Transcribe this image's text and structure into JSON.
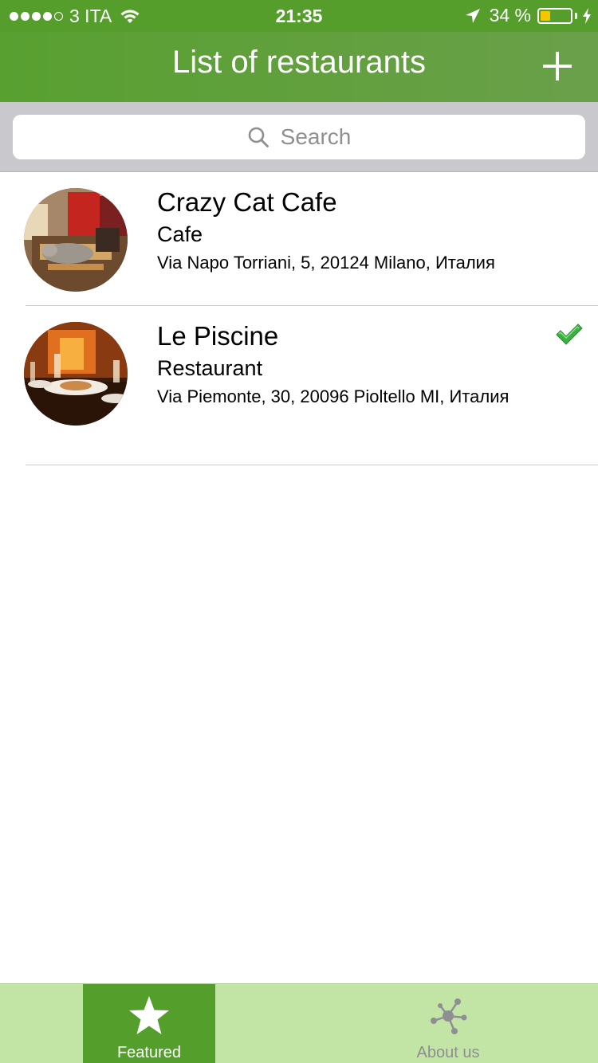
{
  "status_bar": {
    "carrier": "3 ITA",
    "time": "21:35",
    "battery_percent": "34 %",
    "battery_level": 0.34,
    "signal_bars_filled": 4,
    "signal_bars_total": 5
  },
  "nav": {
    "title": "List of restaurants",
    "add_icon": "plus-icon"
  },
  "search": {
    "placeholder": "Search",
    "icon": "magnifier-icon"
  },
  "restaurants": [
    {
      "name": "Crazy Cat Cafe",
      "type": "Cafe",
      "address": "Via Napo Torriani, 5, 20124 Milano, Италия",
      "checked": false
    },
    {
      "name": "Le Piscine",
      "type": "Restaurant",
      "address": "Via Piemonte, 30, 20096 Pioltello MI, Италия",
      "checked": true
    }
  ],
  "tabs": [
    {
      "label": "Featured",
      "icon": "star-icon",
      "selected": true
    },
    {
      "label": "About us",
      "icon": "network-icon",
      "selected": false
    }
  ],
  "colors": {
    "primary_green": "#559e2c",
    "tab_bar_bg": "#c2e5a6",
    "check_green": "#3cb043",
    "battery_yellow": "#f7c600"
  }
}
